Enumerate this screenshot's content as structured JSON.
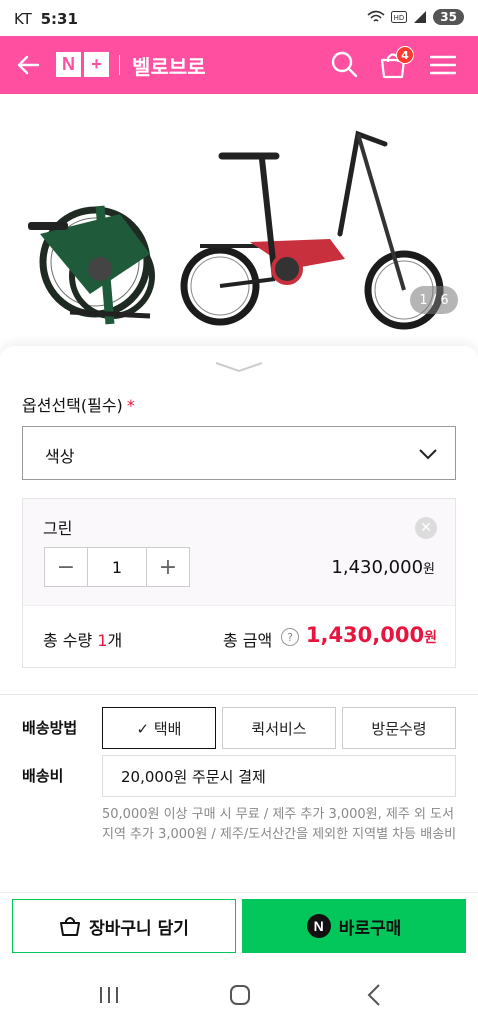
{
  "status_bar": {
    "carrier": "KT",
    "time": "5:31",
    "battery": "35"
  },
  "header": {
    "logo_letter_1": "N",
    "logo_letter_2": "+",
    "store_name": "벨로브로",
    "cart_count": "4"
  },
  "hero": {
    "image_counter": "1 / 6"
  },
  "option": {
    "title": "옵션선택(필수)",
    "required_mark": "*",
    "select_value": "색상"
  },
  "selected_item": {
    "name": "그린",
    "quantity": "1",
    "price": "1,430,000",
    "currency": "원"
  },
  "totals": {
    "qty_label": "총 수량 ",
    "qty_value": "1",
    "qty_unit": "개",
    "amount_label": "총 금액",
    "help": "?",
    "amount": "1,430,000",
    "currency": "원"
  },
  "shipping": {
    "method_label": "배송방법",
    "methods": [
      "✓ 택배",
      "퀵서비스",
      "방문수령"
    ],
    "fee_label": "배송비",
    "fee_value": "20,000원 주문시 결제",
    "fee_note": "50,000원 이상 구매 시 무료 / 제주 추가 3,000원, 제주 외 도서지역 추가 3,000원 / 제주/도서산간을 제외한 지역별 차등 배송비"
  },
  "actions": {
    "cart_label": "장바구니 담기",
    "buy_label": "바로구매",
    "buy_icon": "N"
  },
  "colors": {
    "brand_pink": "#ff4fa0",
    "accent_red": "#e8163f",
    "naver_green": "#03c75a"
  }
}
